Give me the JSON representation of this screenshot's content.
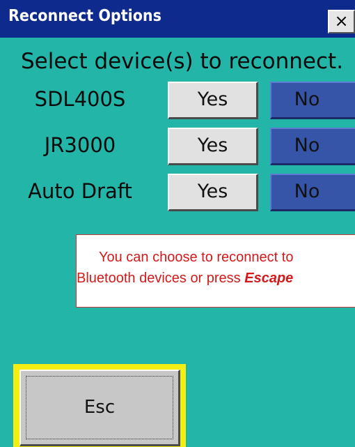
{
  "window": {
    "title": "Reconnect Options",
    "close_glyph": "×",
    "close_icon": "close-icon"
  },
  "main": {
    "heading": "Select device(s) to reconnect.",
    "devices": [
      {
        "name": "SDL400S",
        "yes_label": "Yes",
        "no_label": "No",
        "selected": "No"
      },
      {
        "name": "JR3000",
        "yes_label": "Yes",
        "no_label": "No",
        "selected": "No"
      },
      {
        "name": "Auto Draft",
        "yes_label": "Yes",
        "no_label": "No",
        "selected": "No"
      }
    ],
    "info": {
      "line1": "You can choose to reconnect to",
      "line2_prefix": "Bluetooth devices or press ",
      "line2_emphasis": "Escape"
    },
    "esc_label": "Esc"
  },
  "colors": {
    "background": "#22b5a8",
    "titlebar": "#0d2a8c",
    "yes_button": "#e1e1e1",
    "no_button_selected": "#3654a8",
    "info_text": "#d31a1a",
    "focus_highlight": "#f5ee12"
  }
}
